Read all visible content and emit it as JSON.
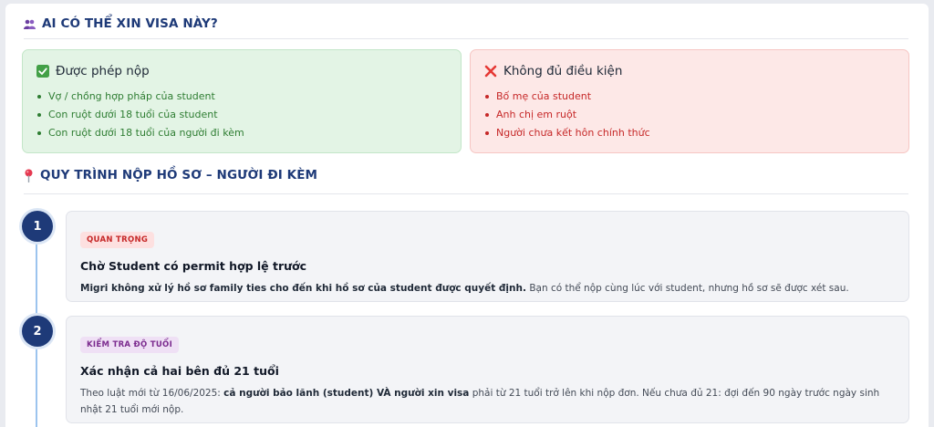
{
  "eligibility": {
    "title": "AI CÓ THỂ XIN VISA NÀY?",
    "allowed": {
      "title": "Được phép nộp",
      "items": [
        "Vợ / chồng hợp pháp của student",
        "Con ruột dưới 18 tuổi của student",
        "Con ruột dưới 18 tuổi của người đi kèm"
      ]
    },
    "denied": {
      "title": "Không đủ điều kiện",
      "items": [
        "Bố mẹ của student",
        "Anh chị em ruột",
        "Người chưa kết hôn chính thức"
      ]
    }
  },
  "process": {
    "title": "QUY TRÌNH NỘP HỒ SƠ – NGƯỜI ĐI KÈM",
    "steps": [
      {
        "number": "1",
        "badge": "QUAN TRỌNG",
        "title": "Chờ Student có permit hợp lệ trước",
        "desc_bold": "Migri không xử lý hồ sơ family ties cho đến khi hồ sơ của student được quyết định.",
        "desc_rest": " Bạn có thể nộp cùng lúc với student, nhưng hồ sơ sẽ được xét sau."
      },
      {
        "number": "2",
        "badge": "KIỂM TRA ĐỘ TUỔI",
        "title": "Xác nhận cả hai bên đủ 21 tuổi",
        "desc_part1": "Theo luật mới từ 16/06/2025: ",
        "desc_bold": "cả người bảo lãnh (student) VÀ người xin visa",
        "desc_part2": " phải từ 21 tuổi trở lên khi nộp đơn. Nếu chưa đủ 21: đợi đến 90 ngày trước ngày sinh nhật 21 tuổi mới nộp."
      }
    ]
  },
  "colors": {
    "accent": "#1e3a78",
    "allowed_bg": "#e3f4e5",
    "allowed_text": "#2e7d32",
    "denied_bg": "#fde8e7",
    "denied_text": "#c62828",
    "timeline": "#9cc4ee"
  },
  "icons": {
    "eligibility": "people-icon",
    "allowed": "check-box-icon",
    "denied": "cross-icon",
    "process": "pin-icon"
  }
}
